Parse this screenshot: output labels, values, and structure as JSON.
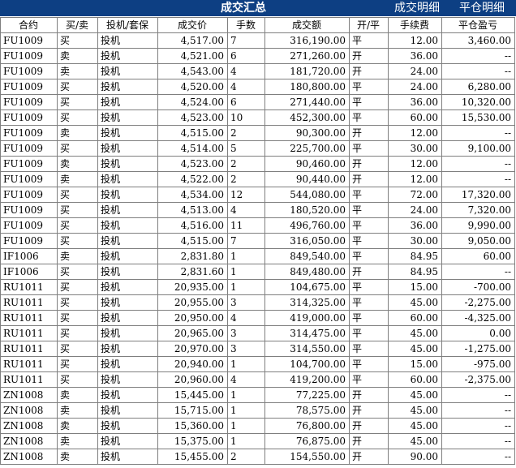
{
  "header": {
    "title": "成交汇总",
    "tab_detail": "成交明细",
    "tab_close": "平仓明细"
  },
  "table": {
    "columns": [
      "合约",
      "买/卖",
      "投机/套保",
      "成交价",
      "手数",
      "成交额",
      "开/平",
      "手续费",
      "平仓盈亏"
    ],
    "rows": [
      [
        "FU1009",
        "买",
        "投机",
        "4,517.00",
        "7",
        "316,190.00",
        "平",
        "12.00",
        "3,460.00"
      ],
      [
        "FU1009",
        "卖",
        "投机",
        "4,521.00",
        "6",
        "271,260.00",
        "开",
        "36.00",
        "--"
      ],
      [
        "FU1009",
        "卖",
        "投机",
        "4,543.00",
        "4",
        "181,720.00",
        "开",
        "24.00",
        "--"
      ],
      [
        "FU1009",
        "买",
        "投机",
        "4,520.00",
        "4",
        "180,800.00",
        "平",
        "24.00",
        "6,280.00"
      ],
      [
        "FU1009",
        "买",
        "投机",
        "4,524.00",
        "6",
        "271,440.00",
        "平",
        "36.00",
        "10,320.00"
      ],
      [
        "FU1009",
        "买",
        "投机",
        "4,523.00",
        "10",
        "452,300.00",
        "平",
        "60.00",
        "15,530.00"
      ],
      [
        "FU1009",
        "卖",
        "投机",
        "4,515.00",
        "2",
        "90,300.00",
        "开",
        "12.00",
        "--"
      ],
      [
        "FU1009",
        "买",
        "投机",
        "4,514.00",
        "5",
        "225,700.00",
        "平",
        "30.00",
        "9,100.00"
      ],
      [
        "FU1009",
        "卖",
        "投机",
        "4,523.00",
        "2",
        "90,460.00",
        "开",
        "12.00",
        "--"
      ],
      [
        "FU1009",
        "卖",
        "投机",
        "4,522.00",
        "2",
        "90,440.00",
        "开",
        "12.00",
        "--"
      ],
      [
        "FU1009",
        "买",
        "投机",
        "4,534.00",
        "12",
        "544,080.00",
        "平",
        "72.00",
        "17,320.00"
      ],
      [
        "FU1009",
        "买",
        "投机",
        "4,513.00",
        "4",
        "180,520.00",
        "平",
        "24.00",
        "7,320.00"
      ],
      [
        "FU1009",
        "买",
        "投机",
        "4,516.00",
        "11",
        "496,760.00",
        "平",
        "36.00",
        "9,990.00"
      ],
      [
        "FU1009",
        "买",
        "投机",
        "4,515.00",
        "7",
        "316,050.00",
        "平",
        "30.00",
        "9,050.00"
      ],
      [
        "IF1006",
        "卖",
        "投机",
        "2,831.80",
        "1",
        "849,540.00",
        "平",
        "84.95",
        "60.00"
      ],
      [
        "IF1006",
        "买",
        "投机",
        "2,831.60",
        "1",
        "849,480.00",
        "开",
        "84.95",
        "--"
      ],
      [
        "RU1011",
        "买",
        "投机",
        "20,935.00",
        "1",
        "104,675.00",
        "平",
        "15.00",
        "-700.00"
      ],
      [
        "RU1011",
        "买",
        "投机",
        "20,955.00",
        "3",
        "314,325.00",
        "平",
        "45.00",
        "-2,275.00"
      ],
      [
        "RU1011",
        "买",
        "投机",
        "20,950.00",
        "4",
        "419,000.00",
        "平",
        "60.00",
        "-4,325.00"
      ],
      [
        "RU1011",
        "买",
        "投机",
        "20,965.00",
        "3",
        "314,475.00",
        "平",
        "45.00",
        "0.00"
      ],
      [
        "RU1011",
        "买",
        "投机",
        "20,970.00",
        "3",
        "314,550.00",
        "平",
        "45.00",
        "-1,275.00"
      ],
      [
        "RU1011",
        "买",
        "投机",
        "20,940.00",
        "1",
        "104,700.00",
        "平",
        "15.00",
        "-975.00"
      ],
      [
        "RU1011",
        "买",
        "投机",
        "20,960.00",
        "4",
        "419,200.00",
        "平",
        "60.00",
        "-2,375.00"
      ],
      [
        "ZN1008",
        "卖",
        "投机",
        "15,445.00",
        "1",
        "77,225.00",
        "开",
        "45.00",
        "--"
      ],
      [
        "ZN1008",
        "卖",
        "投机",
        "15,715.00",
        "1",
        "78,575.00",
        "开",
        "45.00",
        "--"
      ],
      [
        "ZN1008",
        "卖",
        "投机",
        "15,360.00",
        "1",
        "76,800.00",
        "开",
        "45.00",
        "--"
      ],
      [
        "ZN1008",
        "卖",
        "投机",
        "15,375.00",
        "1",
        "76,875.00",
        "开",
        "45.00",
        "--"
      ],
      [
        "ZN1008",
        "卖",
        "投机",
        "15,455.00",
        "2",
        "154,550.00",
        "开",
        "90.00",
        "--"
      ]
    ]
  },
  "colors": {
    "header_bg": "#0d3f83",
    "header_text": "#ffffff",
    "grid_line": "#7f7f7f"
  }
}
